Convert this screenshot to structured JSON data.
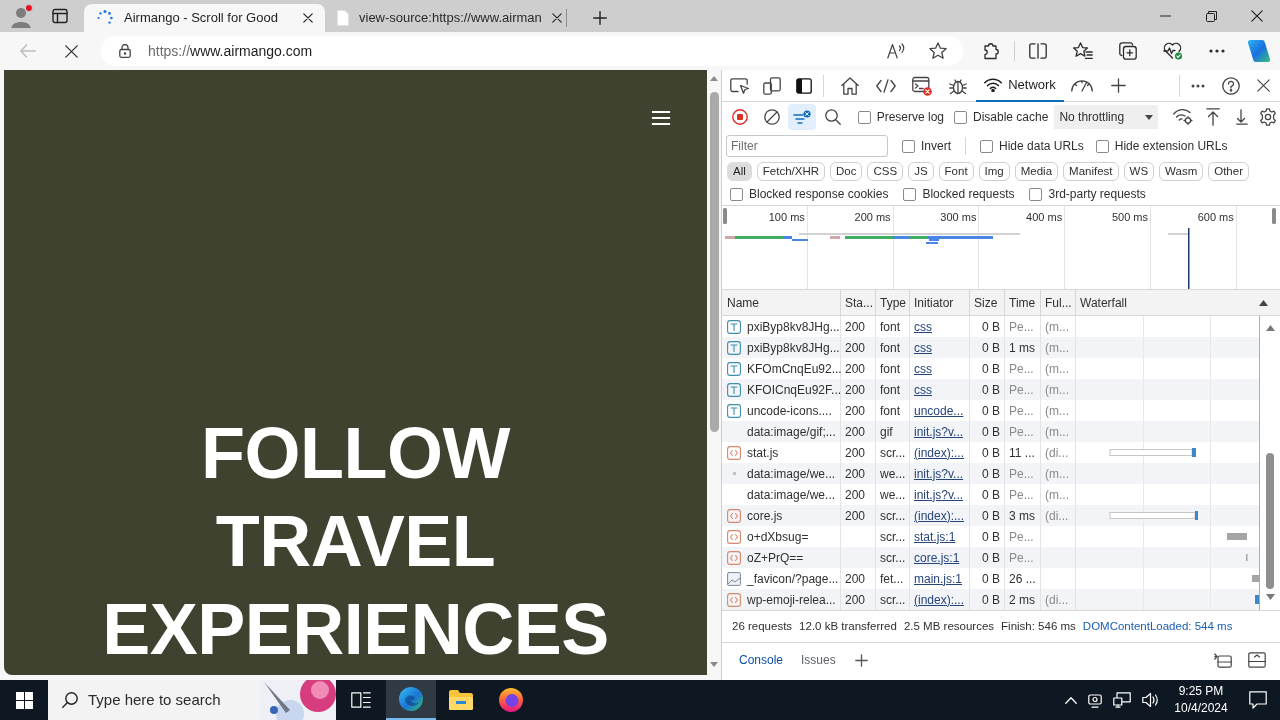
{
  "browser": {
    "tabs": [
      {
        "kind": "loading",
        "title": "Airmango - Scroll for Good",
        "selected": true
      },
      {
        "kind": "source",
        "title": "view-source:https://www.airman",
        "selected": false
      }
    ],
    "back": {
      "disabled": true
    },
    "address": {
      "scheme": "https://",
      "host": "www.airmango.com"
    }
  },
  "page": {
    "heading": "FOLLOW TRAVEL EXPERIENCES"
  },
  "devtools": {
    "panel_tabs": [
      {
        "kind": "welcome",
        "selected": false
      },
      {
        "kind": "elements",
        "selected": false
      },
      {
        "kind": "console",
        "selected": false
      },
      {
        "kind": "sources",
        "selected": false
      },
      {
        "kind": "network",
        "label": "Network",
        "selected": true
      },
      {
        "kind": "performance",
        "selected": false
      }
    ],
    "toolbar": {
      "recording": true,
      "filter_active": true,
      "checkboxes": [
        {
          "label": "Preserve log",
          "checked": false
        },
        {
          "label": "Disable cache",
          "checked": false
        }
      ],
      "throttling": "No throttling"
    },
    "filter": {
      "placeholder": "Filter",
      "options": [
        {
          "label": "Invert",
          "checked": false
        },
        {
          "label": "Hide data URLs",
          "checked": false
        },
        {
          "label": "Hide extension URLs",
          "checked": false
        }
      ]
    },
    "type_filters": [
      {
        "label": "All",
        "selected": true
      },
      {
        "label": "Fetch/XHR",
        "selected": false
      },
      {
        "label": "Doc",
        "selected": false
      },
      {
        "label": "CSS",
        "selected": false
      },
      {
        "label": "JS",
        "selected": false
      },
      {
        "label": "Font",
        "selected": false
      },
      {
        "label": "Img",
        "selected": false
      },
      {
        "label": "Media",
        "selected": false
      },
      {
        "label": "Manifest",
        "selected": false
      },
      {
        "label": "WS",
        "selected": false
      },
      {
        "label": "Wasm",
        "selected": false
      },
      {
        "label": "Other",
        "selected": false
      }
    ],
    "block_options": [
      {
        "label": "Blocked response cookies",
        "checked": false
      },
      {
        "label": "Blocked requests",
        "checked": false
      },
      {
        "label": "3rd-party requests",
        "checked": false
      }
    ],
    "overview": {
      "ticks": [
        "100 ms",
        "200 ms",
        "300 ms",
        "400 ms",
        "500 ms",
        "600 ms"
      ]
    },
    "table": {
      "columns": [
        "Name",
        "Sta...",
        "Type",
        "Initiator",
        "Size",
        "Time",
        "Ful...",
        "Waterfall"
      ],
      "rows": [
        {
          "kind": "font",
          "name": "pxiByp8kv8JHg...",
          "column_2": "200",
          "type": "font",
          "initiator": "css",
          "size": "0 B",
          "time": "Pe...",
          "column_7": "(m...",
          "pending": true
        },
        {
          "kind": "font",
          "name": "pxiByp8kv8JHg...",
          "column_2": "200",
          "type": "font",
          "initiator": "css",
          "size": "0 B",
          "time": "1 ms",
          "column_7": "(m...",
          "pending": false
        },
        {
          "kind": "font",
          "name": "KFOmCnqEu92...",
          "column_2": "200",
          "type": "font",
          "initiator": "css",
          "size": "0 B",
          "time": "Pe...",
          "column_7": "(m...",
          "pending": true
        },
        {
          "kind": "font",
          "name": "KFOICnqEu92F...",
          "column_2": "200",
          "type": "font",
          "initiator": "css",
          "size": "0 B",
          "time": "Pe...",
          "column_7": "(m...",
          "pending": true
        },
        {
          "kind": "font",
          "name": "uncode-icons....",
          "column_2": "200",
          "type": "font",
          "initiator": "uncode...",
          "size": "0 B",
          "time": "Pe...",
          "column_7": "(m...",
          "pending": true
        },
        {
          "kind": "data",
          "name": "data:image/gif;...",
          "column_2": "200",
          "type": "gif",
          "initiator": "init.js?v...",
          "size": "0 B",
          "time": "Pe...",
          "column_7": "(m...",
          "pending": true
        },
        {
          "kind": "script",
          "name": "stat.js",
          "column_2": "200",
          "type": "scr...",
          "initiator": "(index):...",
          "size": "0 B",
          "time": "11 ...",
          "column_7": "(di...",
          "pending": false
        },
        {
          "kind": "dot",
          "name": "data:image/we...",
          "column_2": "200",
          "type": "we...",
          "initiator": "init.js?v...",
          "size": "0 B",
          "time": "Pe...",
          "column_7": "(m...",
          "pending": true
        },
        {
          "kind": "data",
          "name": "data:image/we...",
          "column_2": "200",
          "type": "we...",
          "initiator": "init.js?v...",
          "size": "0 B",
          "time": "Pe...",
          "column_7": "(m...",
          "pending": true
        },
        {
          "kind": "script",
          "name": "core.js",
          "column_2": "200",
          "type": "scr...",
          "initiator": "(index):...",
          "size": "0 B",
          "time": "3 ms",
          "column_7": "(di...",
          "pending": false
        },
        {
          "kind": "script",
          "name": "o+dXbsug=",
          "type": "scr...",
          "initiator": "stat.js:1",
          "size": "0 B",
          "time": "Pe...",
          "pending": true
        },
        {
          "kind": "script",
          "name": "oZ+PrQ==",
          "type": "scr...",
          "initiator": "core.js:1",
          "size": "0 B",
          "time": "Pe...",
          "pending": true
        },
        {
          "kind": "image",
          "name": "_favicon/?page...",
          "column_2": "200",
          "type": "fet...",
          "initiator": "main.js:1",
          "size": "0 B",
          "time": "26 ...",
          "pending": false
        },
        {
          "kind": "script",
          "name": "wp-emoji-relea...",
          "column_2": "200",
          "type": "scr...",
          "initiator": "(index):...",
          "size": "0 B",
          "time": "2 ms",
          "column_7": "(di...",
          "pending": false
        }
      ]
    },
    "status_bar": [
      {
        "text": "26 requests",
        "color": "#303030"
      },
      {
        "text": "12.0 kB transferred",
        "color": "#303030"
      },
      {
        "text": "2.5 MB resources",
        "color": "#303030"
      },
      {
        "text": "Finish: 546 ms",
        "color": "#303030"
      },
      {
        "text": "DOMContentLoaded: 544 ms",
        "color": "#1a5fb4"
      }
    ],
    "drawer_tabs": [
      {
        "label": "Console",
        "selected": true
      },
      {
        "label": "Issues",
        "selected": false
      }
    ]
  },
  "taskbar": {
    "search": {
      "placeholder": "Type here to search"
    },
    "apps": [
      {
        "kind": "task_view",
        "active": false
      },
      {
        "kind": "edge",
        "active": true
      },
      {
        "kind": "explorer",
        "active": false
      },
      {
        "kind": "firefox",
        "active": false
      }
    ],
    "clock": {
      "time": "9:25 PM",
      "date": "10/4/2024"
    }
  }
}
